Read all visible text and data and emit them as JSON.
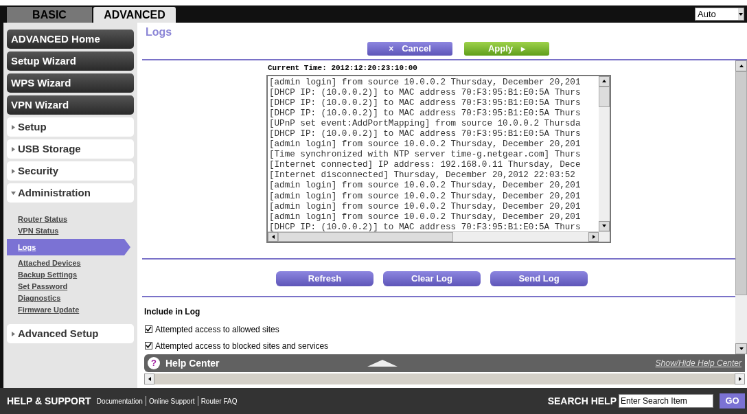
{
  "tabs": [
    {
      "label": "BASIC",
      "selected": false
    },
    {
      "label": "ADVANCED",
      "selected": true
    }
  ],
  "language_select": {
    "value": "Auto"
  },
  "sidebar": {
    "items": [
      {
        "kind": "dark",
        "label": "ADVANCED Home"
      },
      {
        "kind": "dark",
        "label": "Setup Wizard"
      },
      {
        "kind": "dark",
        "label": "WPS Wizard"
      },
      {
        "kind": "dark",
        "label": "VPN Wizard"
      },
      {
        "kind": "section",
        "label": "Setup",
        "expanded": false
      },
      {
        "kind": "section",
        "label": "USB Storage",
        "expanded": false
      },
      {
        "kind": "section",
        "label": "Security",
        "expanded": false
      },
      {
        "kind": "section",
        "label": "Administration",
        "expanded": true,
        "children": [
          {
            "label": "Router Status",
            "selected": false
          },
          {
            "label": "VPN Status",
            "selected": false
          },
          {
            "label": "Logs",
            "selected": true
          },
          {
            "label": "Attached Devices",
            "selected": false
          },
          {
            "label": "Backup Settings",
            "selected": false
          },
          {
            "label": "Set Password",
            "selected": false
          },
          {
            "label": "Diagnostics",
            "selected": false
          },
          {
            "label": "Firmware Update",
            "selected": false
          }
        ]
      },
      {
        "kind": "section",
        "label": "Advanced Setup",
        "expanded": false
      }
    ]
  },
  "page": {
    "title": "Logs",
    "top_buttons": [
      {
        "kind": "cancel",
        "label": "Cancel",
        "icon": "×"
      },
      {
        "kind": "apply",
        "label": "Apply",
        "icon": "▸"
      }
    ],
    "current_time": "Current Time: 2012:12:20:23:10:00",
    "log_lines": [
      "[admin login] from source 10.0.0.2 Thursday, December 20,201",
      "[DHCP IP: (10.0.0.2)] to MAC address 70:F3:95:B1:E0:5A Thurs",
      "[DHCP IP: (10.0.0.2)] to MAC address 70:F3:95:B1:E0:5A Thurs",
      "[DHCP IP: (10.0.0.2)] to MAC address 70:F3:95:B1:E0:5A Thurs",
      "[UPnP set event:AddPortMapping] from source 10.0.0.2 Thursda",
      "[DHCP IP: (10.0.0.2)] to MAC address 70:F3:95:B1:E0:5A Thurs",
      "[admin login] from source 10.0.0.2 Thursday, December 20,201",
      "[Time synchronized with NTP server time-g.netgear.com] Thurs",
      "[Internet connected] IP address: 192.168.0.11 Thursday, Dece",
      "[Internet disconnected] Thursday, December 20,2012 22:03:52",
      "[admin login] from source 10.0.0.2 Thursday, December 20,201",
      "[admin login] from source 10.0.0.2 Thursday, December 20,201",
      "[admin login] from source 10.0.0.2 Thursday, December 20,201",
      "[admin login] from source 10.0.0.2 Thursday, December 20,201",
      "[DHCP IP: (10.0.0.2)] to MAC address 70:F3:95:B1:E0:5A Thurs"
    ],
    "log_buttons": [
      "Refresh",
      "Clear Log",
      "Send Log"
    ],
    "include_heading": "Include in Log",
    "options": [
      {
        "label": "Attempted access to allowed sites",
        "checked": true
      },
      {
        "label": "Attempted access to blocked sites and services",
        "checked": true
      }
    ]
  },
  "help_center": {
    "icon": "?",
    "title": "Help Center",
    "toggle": "Show/Hide Help Center"
  },
  "footer": {
    "title": "HELP & SUPPORT",
    "links": [
      "Documentation",
      "Online Support",
      "Router FAQ"
    ],
    "search_label": "SEARCH HELP",
    "search_placeholder": "Enter Search Item",
    "go": "GO"
  }
}
